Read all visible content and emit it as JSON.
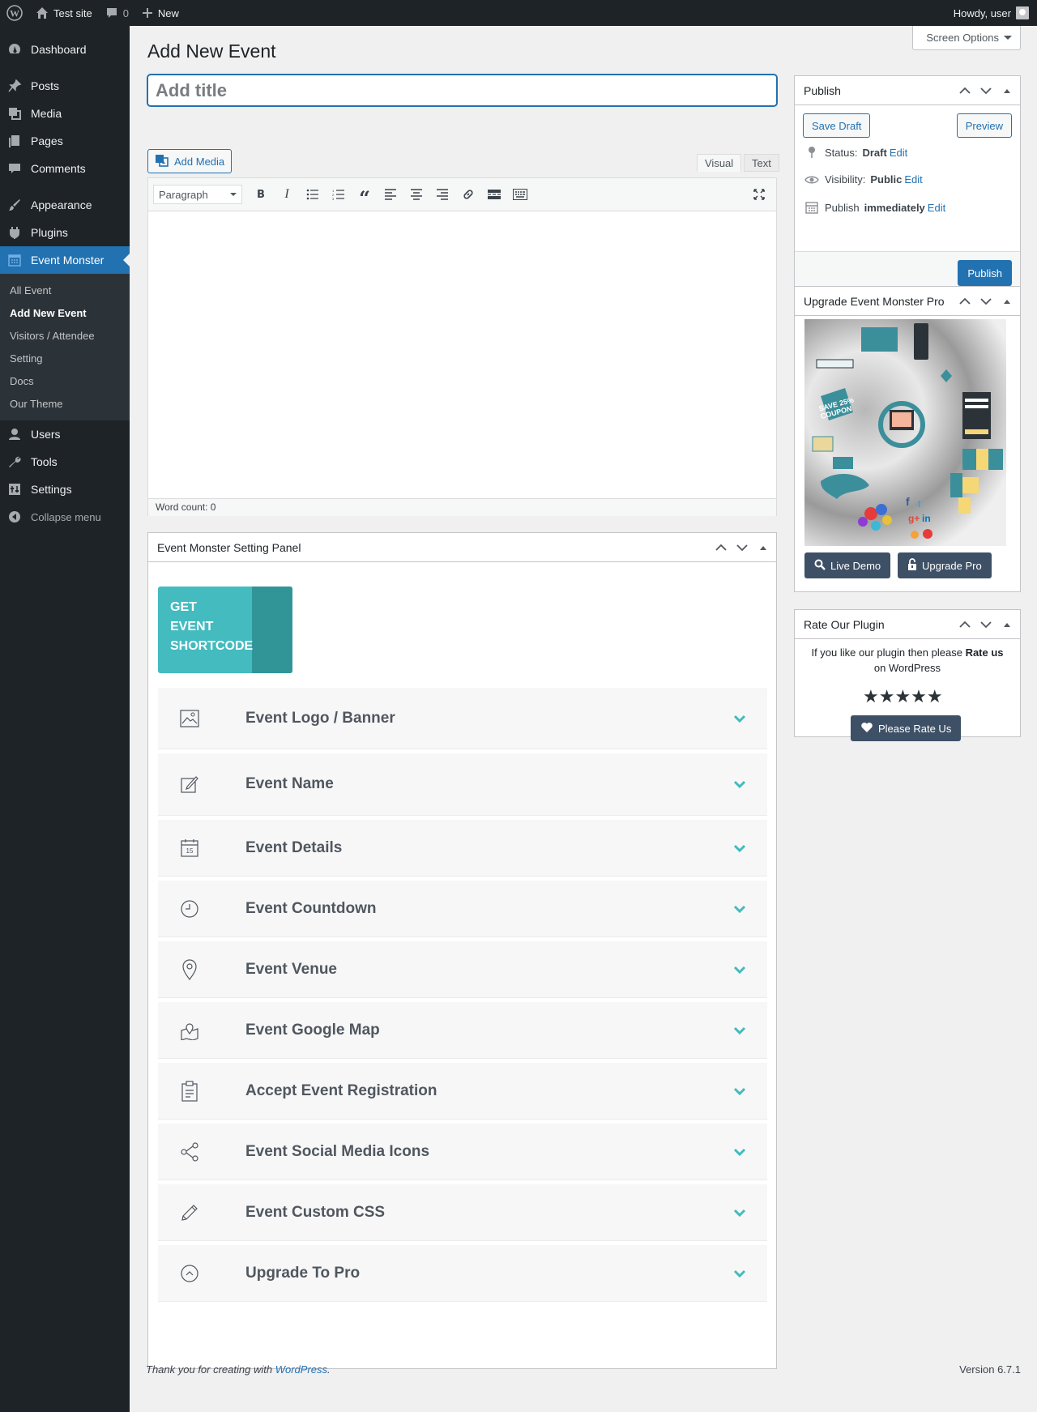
{
  "adminbar": {
    "site_name": "Test site",
    "comments_count": "0",
    "new_label": "New",
    "howdy": "Howdy, user"
  },
  "sidebar": {
    "items": [
      {
        "label": "Dashboard",
        "icon": "dashboard-icon"
      },
      {
        "label": "Posts",
        "icon": "pin-icon"
      },
      {
        "label": "Media",
        "icon": "media-icon"
      },
      {
        "label": "Pages",
        "icon": "pages-icon"
      },
      {
        "label": "Comments",
        "icon": "comments-icon"
      },
      {
        "label": "Appearance",
        "icon": "brush-icon"
      },
      {
        "label": "Plugins",
        "icon": "plug-icon"
      },
      {
        "label": "Event Monster",
        "icon": "calendar-icon"
      },
      {
        "label": "Users",
        "icon": "user-icon"
      },
      {
        "label": "Tools",
        "icon": "wrench-icon"
      },
      {
        "label": "Settings",
        "icon": "settings-icon"
      },
      {
        "label": "Collapse menu",
        "icon": "collapse-icon"
      }
    ],
    "submenu": [
      "All Event",
      "Add New Event",
      "Visitors / Attendee",
      "Setting",
      "Docs",
      "Our Theme"
    ]
  },
  "screen_options": "Screen Options",
  "page_title": "Add New Event",
  "title_placeholder": "Add title",
  "editor": {
    "add_media": "Add Media",
    "tab_visual": "Visual",
    "tab_text": "Text",
    "format": "Paragraph",
    "word_count": "Word count: 0"
  },
  "settings_panel": {
    "title": "Event Monster Setting Panel",
    "shortcode_lines": [
      "GET",
      "EVENT",
      "SHORTCODE"
    ],
    "sections": [
      {
        "title": "Event Logo / Banner",
        "icon": "image-icon"
      },
      {
        "title": "Event Name",
        "icon": "edit-icon"
      },
      {
        "title": "Event Details",
        "icon": "calendar-icon"
      },
      {
        "title": "Event Countdown",
        "icon": "clock-icon"
      },
      {
        "title": "Event Venue",
        "icon": "location-pin-icon"
      },
      {
        "title": "Event Google Map",
        "icon": "map-icon"
      },
      {
        "title": "Accept Event Registration",
        "icon": "clipboard-icon"
      },
      {
        "title": "Event Social Media Icons",
        "icon": "share-icon"
      },
      {
        "title": "Event Custom CSS",
        "icon": "pencil-icon"
      },
      {
        "title": "Upgrade To Pro",
        "icon": "arrow-up-circle-icon"
      }
    ]
  },
  "publish": {
    "title": "Publish",
    "save_draft": "Save Draft",
    "preview": "Preview",
    "status_label": "Status:",
    "status_value": "Draft",
    "visibility_label": "Visibility:",
    "visibility_value": "Public",
    "publish_label": "Publish",
    "publish_value": "immediately",
    "edit": "Edit",
    "publish_button": "Publish"
  },
  "upgrade_box": {
    "title": "Upgrade Event Monster Pro",
    "live_demo": "Live Demo",
    "upgrade_pro": "Upgrade Pro"
  },
  "rate_box": {
    "title": "Rate Our Plugin",
    "text_pre": "If you like our plugin then please",
    "text_bold": "Rate us",
    "text_post": "on WordPress",
    "stars": "★★★★★",
    "button": "Please Rate Us"
  },
  "footer": {
    "thanks_pre": "Thank you for creating with",
    "thanks_link": "WordPress",
    "thanks_post": ".",
    "version": "Version 6.7.1"
  },
  "colors": {
    "accent": "#2271b1",
    "teal": "#43bbbf",
    "sidebar": "#1d2327"
  }
}
